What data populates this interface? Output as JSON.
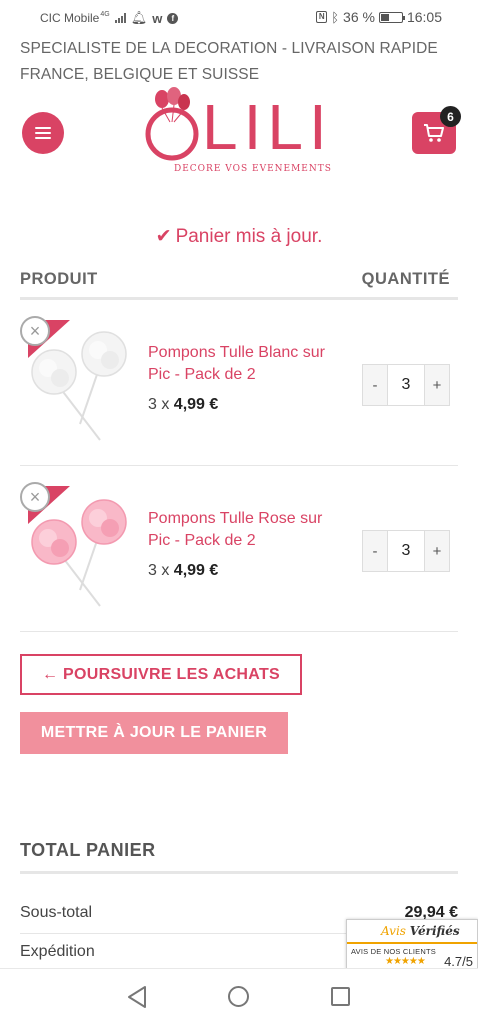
{
  "status_bar": {
    "carrier": "CIC Mobile",
    "network": "4G",
    "battery": "36 %",
    "time": "16:05",
    "icons": [
      "signal-icon",
      "snapchat-icon",
      "w-app-icon",
      "facebook-icon",
      "nfc-icon",
      "bluetooth-icon",
      "battery-icon"
    ]
  },
  "banner": {
    "text": "SPECIALISTE DE LA DECORATION - LIVRAISON RAPIDE FRANCE, BELGIQUE ET SUISSE"
  },
  "header": {
    "logo_text": "LILI",
    "logo_tagline": "DECORE VOS EVENEMENTS",
    "cart_count": "6",
    "brand_color": "#d94364"
  },
  "message": {
    "text": "Panier mis à jour."
  },
  "table": {
    "col_product": "PRODUIT",
    "col_quantity": "QUANTITÉ"
  },
  "items": [
    {
      "name": "Pompons Tulle Blanc sur Pic - Pack de 2",
      "qty_prefix": "3 x ",
      "price": "4,99 €",
      "quantity": "3",
      "minus": "-",
      "plus": "+",
      "color": "#ffffff"
    },
    {
      "name": "Pompons Tulle Rose sur Pic - Pack de 2",
      "qty_prefix": "3 x ",
      "price": "4,99 €",
      "quantity": "3",
      "minus": "-",
      "plus": "+",
      "color": "#f7a8bd"
    }
  ],
  "buttons": {
    "continue": "← POURSUIVRE LES ACHATS",
    "update": "METTRE À JOUR LE PANIER"
  },
  "totals": {
    "title": "TOTAL PANIER",
    "subtotal_label": "Sous-total",
    "subtotal_value": "29,94 €",
    "shipping_label": "Expédition"
  },
  "avis": {
    "brand_1": "Avis",
    "brand_2": "Vérifiés",
    "subtitle": "AVIS DE NOS CLIENTS",
    "stars": "★★★★★",
    "rating": "4.7/5"
  }
}
